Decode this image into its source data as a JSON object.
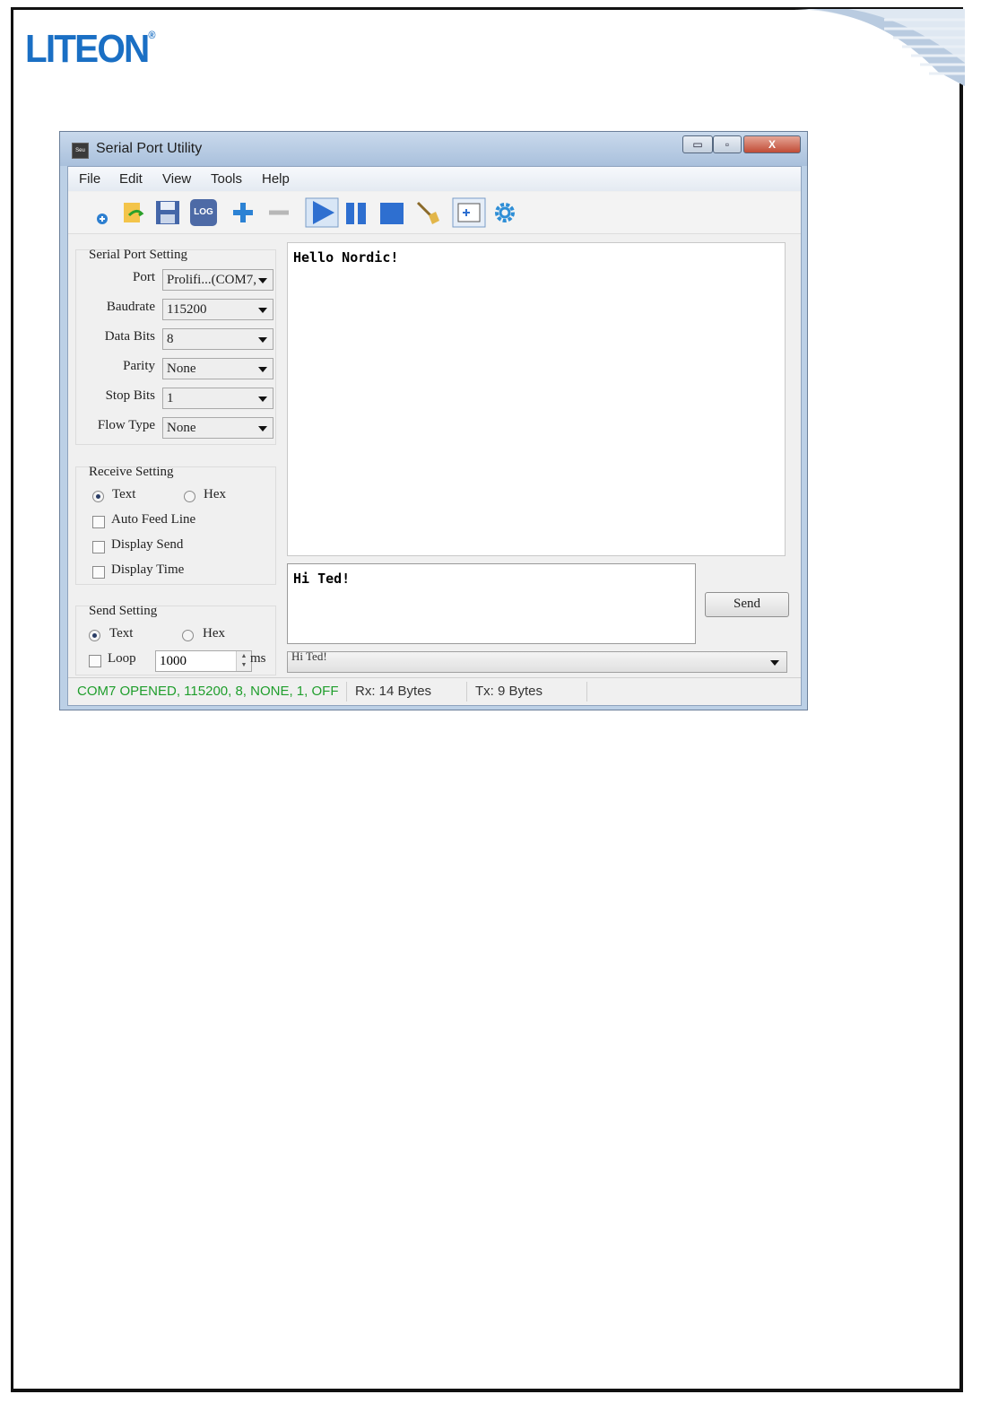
{
  "brand": {
    "logo_text": "LITEON",
    "logo_mark": "®",
    "color": "#1a6fc4"
  },
  "window": {
    "title": "Serial Port Utility",
    "icon_label": "Seu",
    "controls": {
      "minimize": "▭",
      "maximize": "▫",
      "close": "X"
    }
  },
  "menu": [
    "File",
    "Edit",
    "View",
    "Tools",
    "Help"
  ],
  "toolbar": {
    "items": [
      "new-icon",
      "open-icon",
      "save-icon",
      "log-icon",
      "add-icon",
      "remove-icon",
      "play-icon",
      "pause-icon",
      "stop-icon",
      "clear-icon",
      "window-icon",
      "settings-icon"
    ],
    "log_label": "LOG"
  },
  "serial_setting": {
    "title": "Serial Port Setting",
    "fields": [
      {
        "label": "Port",
        "value": "Prolifi...(COM7,"
      },
      {
        "label": "Baudrate",
        "value": "115200"
      },
      {
        "label": "Data Bits",
        "value": "8"
      },
      {
        "label": "Parity",
        "value": "None"
      },
      {
        "label": "Stop Bits",
        "value": "1"
      },
      {
        "label": "Flow Type",
        "value": "None"
      }
    ]
  },
  "receive_setting": {
    "title": "Receive Setting",
    "text_label": "Text",
    "hex_label": "Hex",
    "selected": "Text",
    "options": [
      {
        "label": "Auto Feed Line",
        "checked": false
      },
      {
        "label": "Display Send",
        "checked": false
      },
      {
        "label": "Display Time",
        "checked": false
      }
    ]
  },
  "send_setting": {
    "title": "Send Setting",
    "text_label": "Text",
    "hex_label": "Hex",
    "selected": "Text",
    "loop_label": "Loop",
    "loop_checked": false,
    "loop_value": "1000",
    "loop_unit": "ms"
  },
  "receive_area": {
    "content": "Hello Nordic!"
  },
  "send_area": {
    "content": "Hi Ted!",
    "button": "Send",
    "history": "Hi Ted!"
  },
  "status": {
    "connection": "COM7 OPENED, 115200, 8, NONE, 1, OFF",
    "connection_color": "#1f9e2c",
    "rx": "Rx: 14 Bytes",
    "tx": "Tx: 9 Bytes"
  }
}
